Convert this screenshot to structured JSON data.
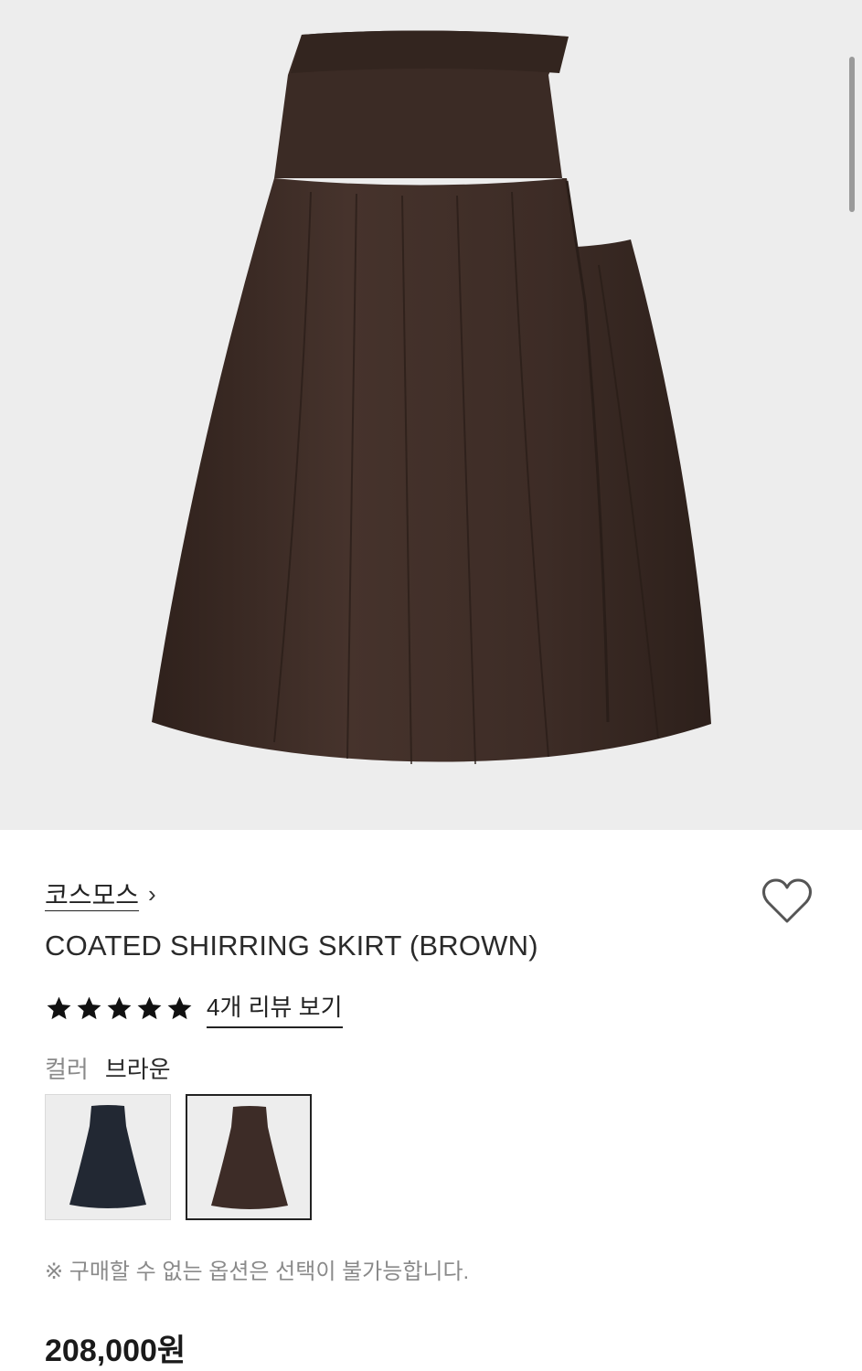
{
  "product": {
    "image_alt": "brown coated shirring skirt",
    "brand": "코스모스",
    "brand_chevron": "›",
    "title": "COATED SHIRRING SKIRT (BROWN)",
    "rating": 5,
    "rating_max": 5,
    "review_link": "4개 리뷰 보기",
    "option_label": "컬러",
    "option_value": "브라운",
    "swatches": [
      {
        "color": "#222833",
        "selected": false
      },
      {
        "color": "#3d2c27",
        "selected": true
      }
    ],
    "notice": "※ 구매할 수 없는 옵션은 선택이 불가능합니다.",
    "price": "208,000원",
    "skirt_color": "#3f2d27"
  }
}
